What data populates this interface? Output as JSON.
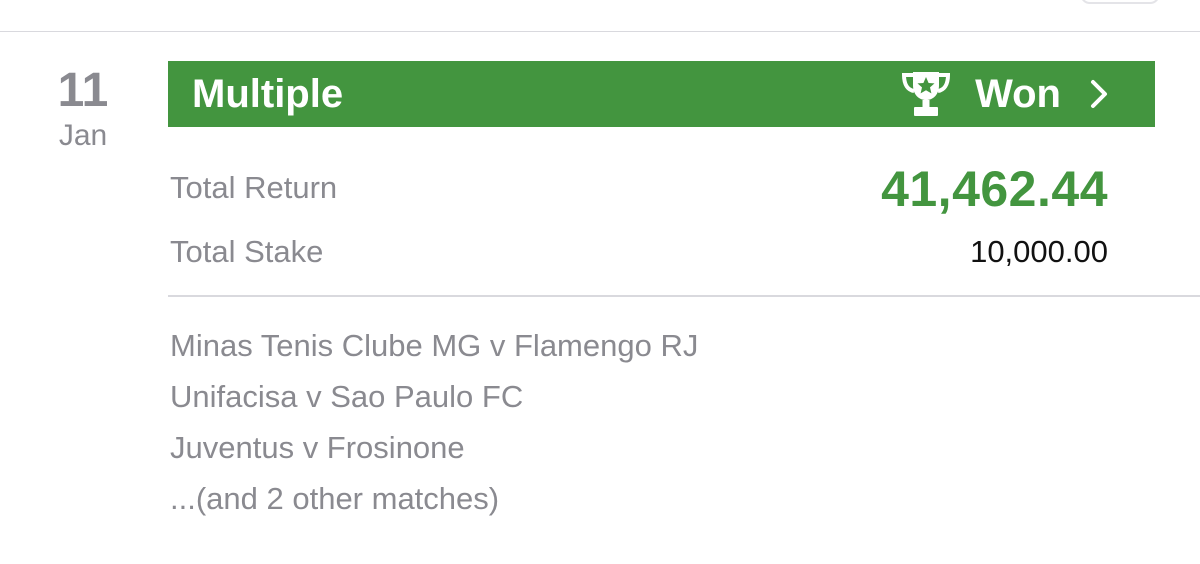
{
  "date": {
    "day": "11",
    "month": "Jan"
  },
  "bet": {
    "type": "Multiple",
    "status": "Won",
    "status_icon": "trophy-icon",
    "chevron_icon": "chevron-right-icon",
    "accent_color": "#43953f"
  },
  "totals": {
    "return_label": "Total Return",
    "return_value": "41,462.44",
    "stake_label": "Total Stake",
    "stake_value": "10,000.00"
  },
  "matches": [
    "Minas Tenis Clube MG v Flamengo RJ",
    "Unifacisa v Sao Paulo FC",
    "Juventus v Frosinone",
    "...(and 2 other matches)"
  ]
}
